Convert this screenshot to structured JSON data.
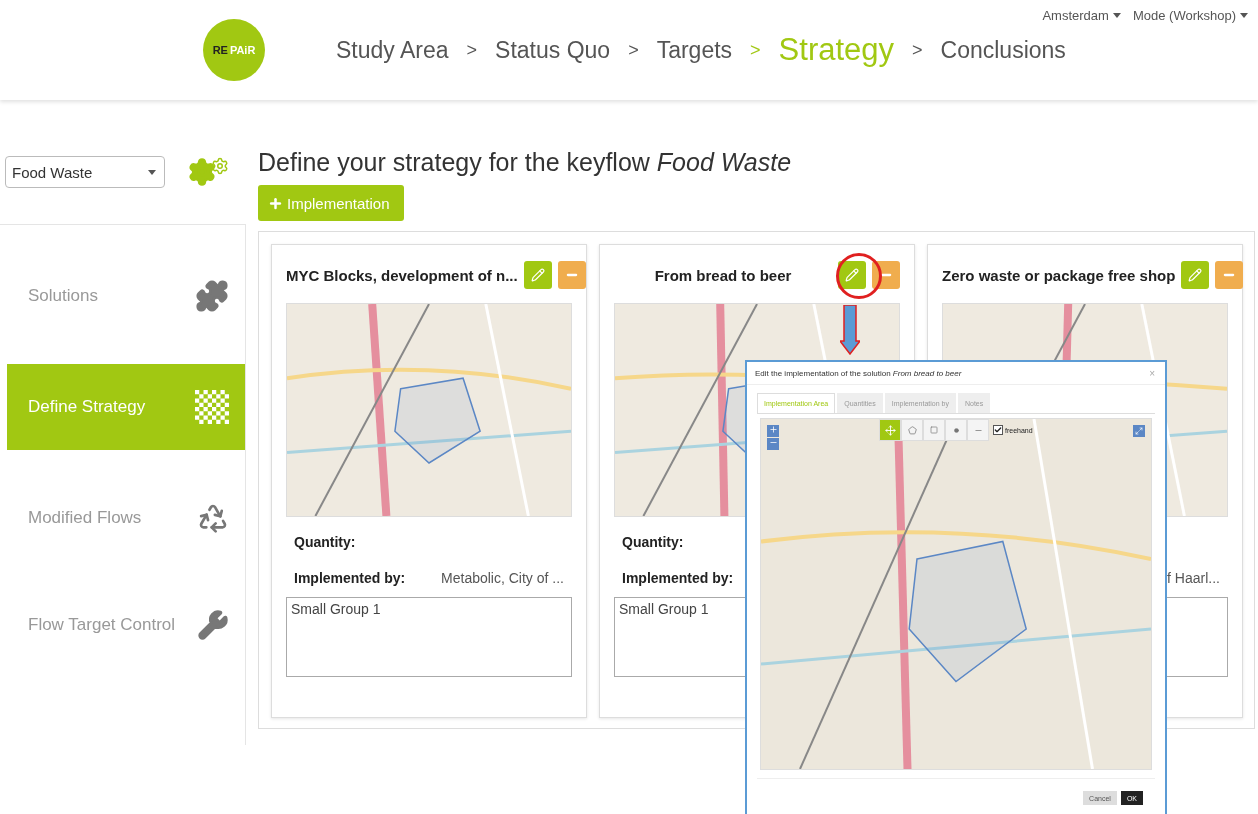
{
  "top_menu": [
    {
      "label": "Amsterdam"
    },
    {
      "label": "Mode (Workshop)"
    }
  ],
  "logo": {
    "text_1": "RE",
    "text_2": "PAiR"
  },
  "steps": [
    {
      "label": "Study Area",
      "selected": false
    },
    {
      "separator": ">",
      "label": "Status Quo",
      "selected": false
    },
    {
      "separator": ">",
      "label": "Targets",
      "selected": false
    },
    {
      "separator": ">",
      "label": "Strategy",
      "selected": true
    },
    {
      "separator": ">",
      "label": "Conclusions",
      "selected": false
    }
  ],
  "keyflow_select": {
    "value": "Food Waste"
  },
  "sidebar": {
    "items": [
      {
        "kind": "puzzle",
        "label": "Solutions",
        "selected": false
      },
      {
        "kind": "checker",
        "label": "Define Strategy",
        "selected": true
      },
      {
        "kind": "recycle",
        "label": "Modified Flows",
        "selected": false
      },
      {
        "kind": "wrench",
        "label": "Flow Target Control",
        "selected": false
      }
    ]
  },
  "page_title": "Define your strategy for the keyflow *Food Waste*",
  "add_button": {
    "label": "Implementation"
  },
  "cards": [
    {
      "title": "MYC Blocks, development of n...",
      "quantity_label": "Quantity:",
      "implemented_by_label": "Implemented by:",
      "implemented_by_value": "Metabolic, City of ...",
      "notes": "Small Group 1"
    },
    {
      "title": "From bread to beer",
      "quantity_label": "Quantity:",
      "implemented_by_label": "Implemented by:",
      "notes": "Small Group 1"
    },
    {
      "title": "Zero waste or package free shop",
      "implemented_by_value": "f Haarl..."
    }
  ],
  "modal": {
    "title": "Edit the implementation of the solution *From bread to beer*",
    "close": "×",
    "tabs": [
      {
        "label": "Implementation Area",
        "selected": true
      },
      {
        "label": "Quantities",
        "selected": false
      },
      {
        "label": "Implementation by",
        "selected": false
      },
      {
        "label": "Notes",
        "selected": false
      }
    ],
    "map_tools": [
      {
        "kind": "move",
        "selected": true
      },
      {
        "kind": "polygon",
        "selected": false
      },
      {
        "kind": "rectangle",
        "selected": false
      },
      {
        "kind": "point",
        "selected": false
      },
      {
        "kind": "line",
        "selected": false
      }
    ],
    "freehand": {
      "label": "freehand",
      "checked": true
    },
    "buttons": [
      {
        "kind": "cancel",
        "label": "Cancel"
      },
      {
        "kind": "ok",
        "label": "OK"
      }
    ]
  }
}
